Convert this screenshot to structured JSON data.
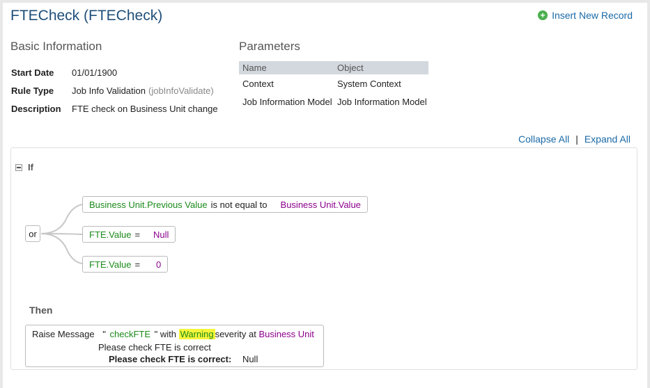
{
  "header": {
    "title": "FTECheck (FTECheck)",
    "insert_label": "Insert New Record"
  },
  "basic_info": {
    "title": "Basic Information",
    "rows": [
      {
        "key": "Start Date",
        "value": "01/01/1900",
        "extra": ""
      },
      {
        "key": "Rule Type",
        "value": "Job Info Validation",
        "extra": "(jobInfoValidate)"
      },
      {
        "key": "Description",
        "value": "FTE check on Business Unit change",
        "extra": ""
      }
    ]
  },
  "parameters": {
    "title": "Parameters",
    "columns": [
      "Name",
      "Object"
    ],
    "rows": [
      [
        "Context",
        "System Context"
      ],
      [
        "Job Information Model",
        "Job Information Model"
      ]
    ]
  },
  "controls": {
    "collapse_all": "Collapse All",
    "separator": "|",
    "expand_all": "Expand All"
  },
  "rule": {
    "if_label": "If",
    "operator": "or",
    "conditions": [
      {
        "left": "Business Unit.Previous Value",
        "op": "is not equal to",
        "right": "Business Unit.Value"
      },
      {
        "left": "FTE.Value",
        "op": "=",
        "right": "Null"
      },
      {
        "left": "FTE.Value",
        "op": "=",
        "right": "0"
      }
    ],
    "then_label": "Then",
    "action": {
      "prefix": "Raise Message",
      "quote_open": "\"",
      "message_key": "checkFTE",
      "quote_close": "\"",
      "with": "with",
      "severity": "Warning",
      "severity_at": "severity at",
      "target": "Business Unit",
      "line2": "Please check FTE is correct",
      "line3_label": "Please check FTE is correct:",
      "line3_value": "Null"
    }
  },
  "colors": {
    "title": "#1f4e79",
    "link": "#1a6aa6",
    "field": "#1b8a1b",
    "value": "#8b008b",
    "highlight": "#f5f53a"
  }
}
